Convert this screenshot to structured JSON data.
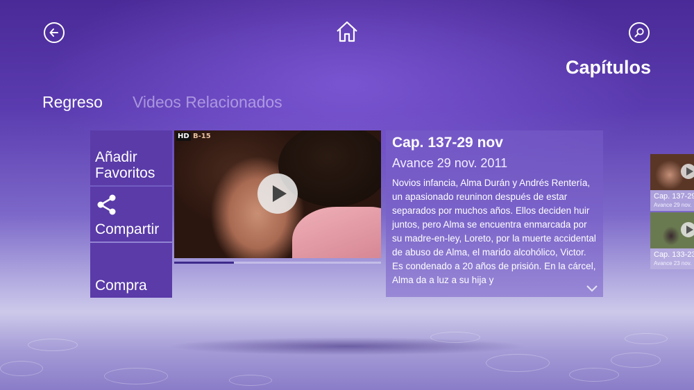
{
  "header": {
    "back_icon": "back-arrow-icon",
    "home_icon": "home-icon",
    "search_icon": "search-icon",
    "page_title": "Capítulos"
  },
  "nav": {
    "tabs": [
      {
        "label": "Regreso",
        "active": true
      },
      {
        "label": "Videos Relacionados",
        "active": false
      }
    ]
  },
  "actions": [
    {
      "label_line1": "Añadir",
      "label_line2": "Favoritos",
      "icon": ""
    },
    {
      "label_line1": "Compartir",
      "label_line2": "",
      "icon": "share-icon"
    },
    {
      "label_line1": "Compra",
      "label_line2": "",
      "icon": ""
    }
  ],
  "video": {
    "hd_badge": "HD",
    "rating": "B-15",
    "play_icon": "play-icon",
    "progress": 0.29
  },
  "episode": {
    "title": "Cap. 137-29 nov",
    "subtitle": "Avance 29 nov. 2011",
    "description": "Novios infancia, Alma Durán y Andrés Rentería, un apasionado reuninon después de estar separados por muchos años. Ellos deciden huir juntos, pero Alma se encuentra enmarcada por su madre-en-ley, Loreto, por la muerte accidental de abuso de Alma, el marido alcohólico, Victor. Es condenado a 20 años de prisión. En la cárcel, Alma da a luz a su hija y",
    "more_icon": "chevron-down-icon"
  },
  "related": [
    {
      "title": "Cap. 137-29",
      "date": "Avance 29 nov."
    },
    {
      "title": "Cap. 133-23",
      "date": "Avance 23 nov."
    }
  ],
  "colors": {
    "tile": "#5a3ba8",
    "panel": "#7a5fc8",
    "accent": "#3e2a8a"
  }
}
